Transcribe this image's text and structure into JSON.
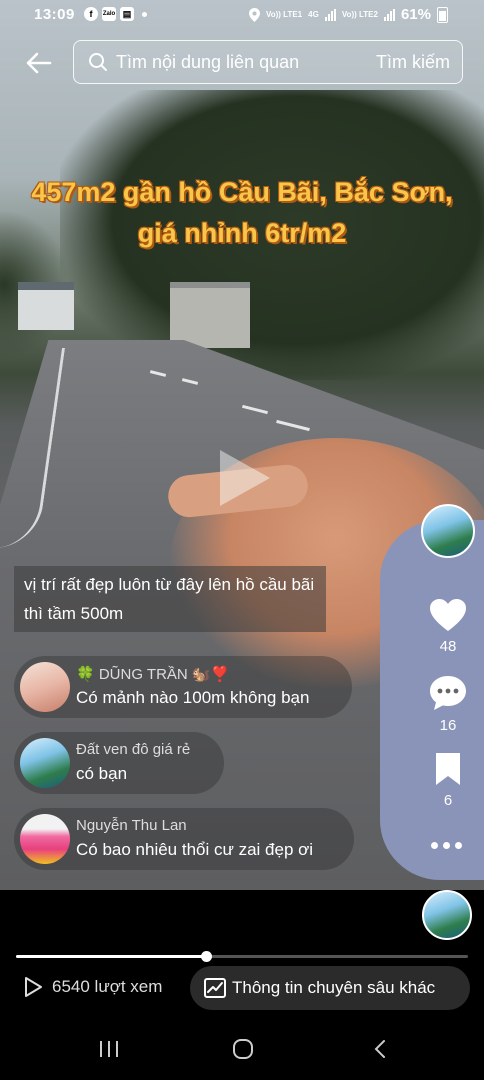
{
  "status_bar": {
    "time": "13:09",
    "app_icons": [
      "facebook-icon",
      "zalo-icon",
      "news-icon"
    ],
    "battery": "61%",
    "net1": "Vo)) LTE1",
    "net2": "4G",
    "net3": "Vo)) LTE2"
  },
  "search": {
    "placeholder": "Tìm nội dung liên quan",
    "button_label": "Tìm kiếm"
  },
  "video": {
    "overlay_title": "457m2 gần hồ Cầu Bãi, Bắc Sơn, giá nhỉnh 6tr/m2",
    "caption": "vị trí rất đẹp luôn từ đây lên hồ cầu bãi thì tầm 500m"
  },
  "actions": {
    "likes": "48",
    "comments": "16",
    "saves": "6"
  },
  "comments": [
    {
      "name": "🍀 DŨNG TRẦN 🐿️❣️",
      "text": "Có mảnh nào 100m không bạn"
    },
    {
      "name": "Đất ven đô giá rẻ",
      "text": "có bạn"
    },
    {
      "name": "Nguyễn Thu Lan",
      "text": "Có bao nhiêu thổi cư zai đẹp ơi"
    }
  ],
  "playback": {
    "progress": 0.42
  },
  "footer": {
    "views": "6540 lượt xem",
    "more_info": "Thông tin chuyên sâu khác"
  },
  "colors": {
    "title_fill": "#f7c64a",
    "title_stroke": "#b05a10"
  }
}
